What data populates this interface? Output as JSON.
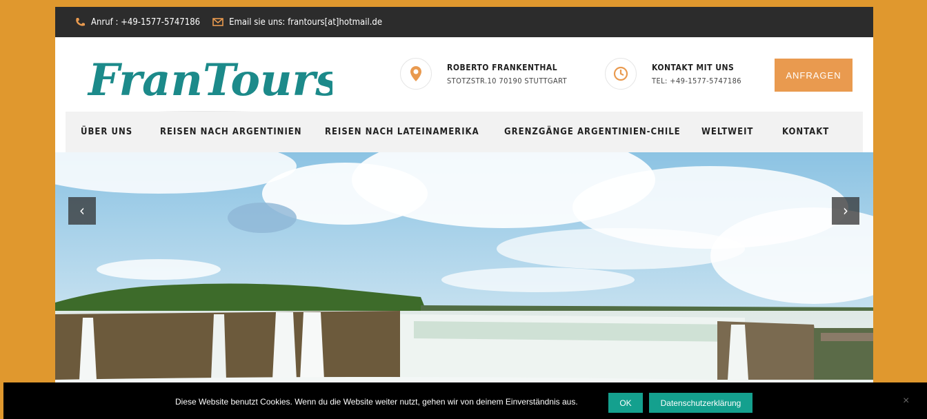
{
  "colors": {
    "frame": "#e0982e",
    "accent": "#e99a4f",
    "teal": "#14a08e",
    "logo_teal": "#1c8a8a",
    "dark": "#2c2c2c"
  },
  "topbar": {
    "phone_icon": "phone-icon",
    "phone": "Anruf : +49-1577-5747186",
    "mail_icon": "envelope-icon",
    "email": "Email sie uns: frantours[at]hotmail.de"
  },
  "logo": {
    "text": "FranTours"
  },
  "header": {
    "contact1_icon": "map-pin-icon",
    "contact1_title": "ROBERTO FRANKENTHAL",
    "contact1_sub": "STOTZSTR.10 70190 STUTTGART",
    "contact2_icon": "clock-icon",
    "contact2_title": "KONTAKT MIT UNS",
    "contact2_sub": "TEL: +49-1577-5747186",
    "cta": "ANFRAGEN"
  },
  "nav": {
    "items": [
      {
        "label": "ÜBER UNS"
      },
      {
        "label": "REISEN NACH ARGENTINIEN"
      },
      {
        "label": "REISEN NACH LATEINAMERIKA"
      },
      {
        "label": "GRENZGÄNGE ARGENTINIEN-CHILE"
      },
      {
        "label": "WELTWEIT"
      },
      {
        "label": "KONTAKT"
      }
    ]
  },
  "slider": {
    "prev": "‹",
    "next": "›"
  },
  "cookie": {
    "message": "Diese Website benutzt Cookies. Wenn du die Website weiter nutzt, gehen wir von deinem Einverständnis aus.",
    "ok": "OK",
    "privacy": "Datenschutzerklärung",
    "close": "×"
  }
}
